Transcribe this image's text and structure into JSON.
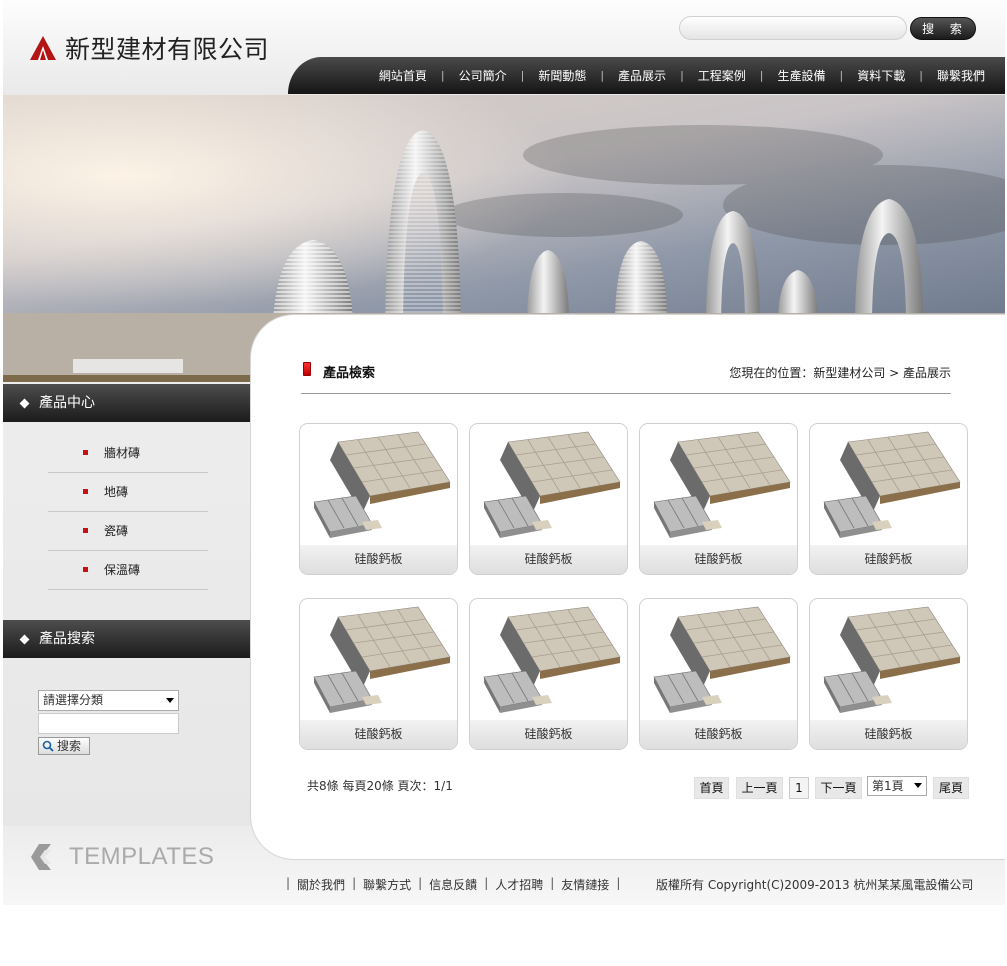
{
  "header": {
    "company_name": "新型建材有限公司",
    "search_button": "搜 索"
  },
  "nav": [
    {
      "label": "網站首頁"
    },
    {
      "label": "公司簡介"
    },
    {
      "label": "新聞動態"
    },
    {
      "label": "產品展示"
    },
    {
      "label": "工程案例"
    },
    {
      "label": "生產設備"
    },
    {
      "label": "資料下載"
    },
    {
      "label": "聯繫我們"
    }
  ],
  "sidebar": {
    "product_center_title": "產品中心",
    "categories": [
      {
        "label": "牆材磚"
      },
      {
        "label": "地磚"
      },
      {
        "label": "瓷磚"
      },
      {
        "label": "保溫磚"
      }
    ],
    "product_search_title": "產品搜索",
    "category_select_value": "請選擇分類",
    "search_button": "搜索"
  },
  "main": {
    "title": "產品檢索",
    "breadcrumb": "您現在的位置：新型建材公司 > 產品展示",
    "products": [
      {
        "name": "硅酸鈣板"
      },
      {
        "name": "硅酸鈣板"
      },
      {
        "name": "硅酸鈣板"
      },
      {
        "name": "硅酸鈣板"
      },
      {
        "name": "硅酸鈣板"
      },
      {
        "name": "硅酸鈣板"
      },
      {
        "name": "硅酸鈣板"
      },
      {
        "name": "硅酸鈣板"
      }
    ],
    "pager": {
      "info": "共8條 每頁20條 頁次：1/1",
      "first": "首頁",
      "prev": "上一頁",
      "current": "1",
      "next": "下一頁",
      "select_value": "第1頁",
      "last": "尾頁"
    }
  },
  "footer": {
    "logo_text": "TEMPLATES",
    "links": [
      {
        "label": "關於我們"
      },
      {
        "label": "聯繫方式"
      },
      {
        "label": "信息反饋"
      },
      {
        "label": "人才招聘"
      },
      {
        "label": "友情鏈接"
      }
    ],
    "copyright": "版權所有 Copyright(C)2009-2013 杭州某某風電設備公司"
  },
  "colors": {
    "accent_red": "#c41212",
    "dark_bar": "#1b1b1b"
  }
}
